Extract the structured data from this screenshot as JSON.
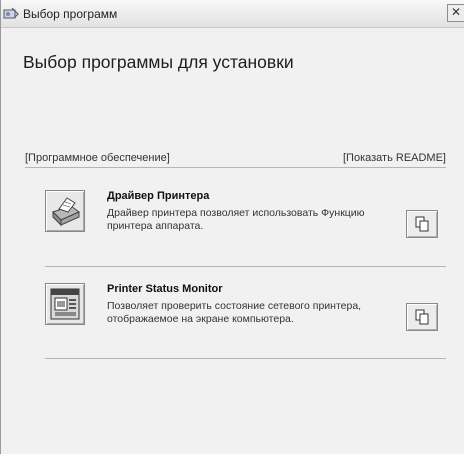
{
  "window": {
    "title": "Выбор программ",
    "close_symbol": "✕"
  },
  "heading": "Выбор программы для установки",
  "links": {
    "software": "[Программное обеспечение]",
    "readme": "[Показать README]"
  },
  "items": [
    {
      "title": "Драйвер Принтера",
      "description": "Драйвер принтера позволяет использовать Функцию принтера аппарата.",
      "icon": "printer-icon"
    },
    {
      "title": "Printer Status Monitor",
      "description": "Позволяет проверить состояние сетевого принтера, отображаемое на экране компьютера.",
      "icon": "status-monitor-icon"
    }
  ]
}
